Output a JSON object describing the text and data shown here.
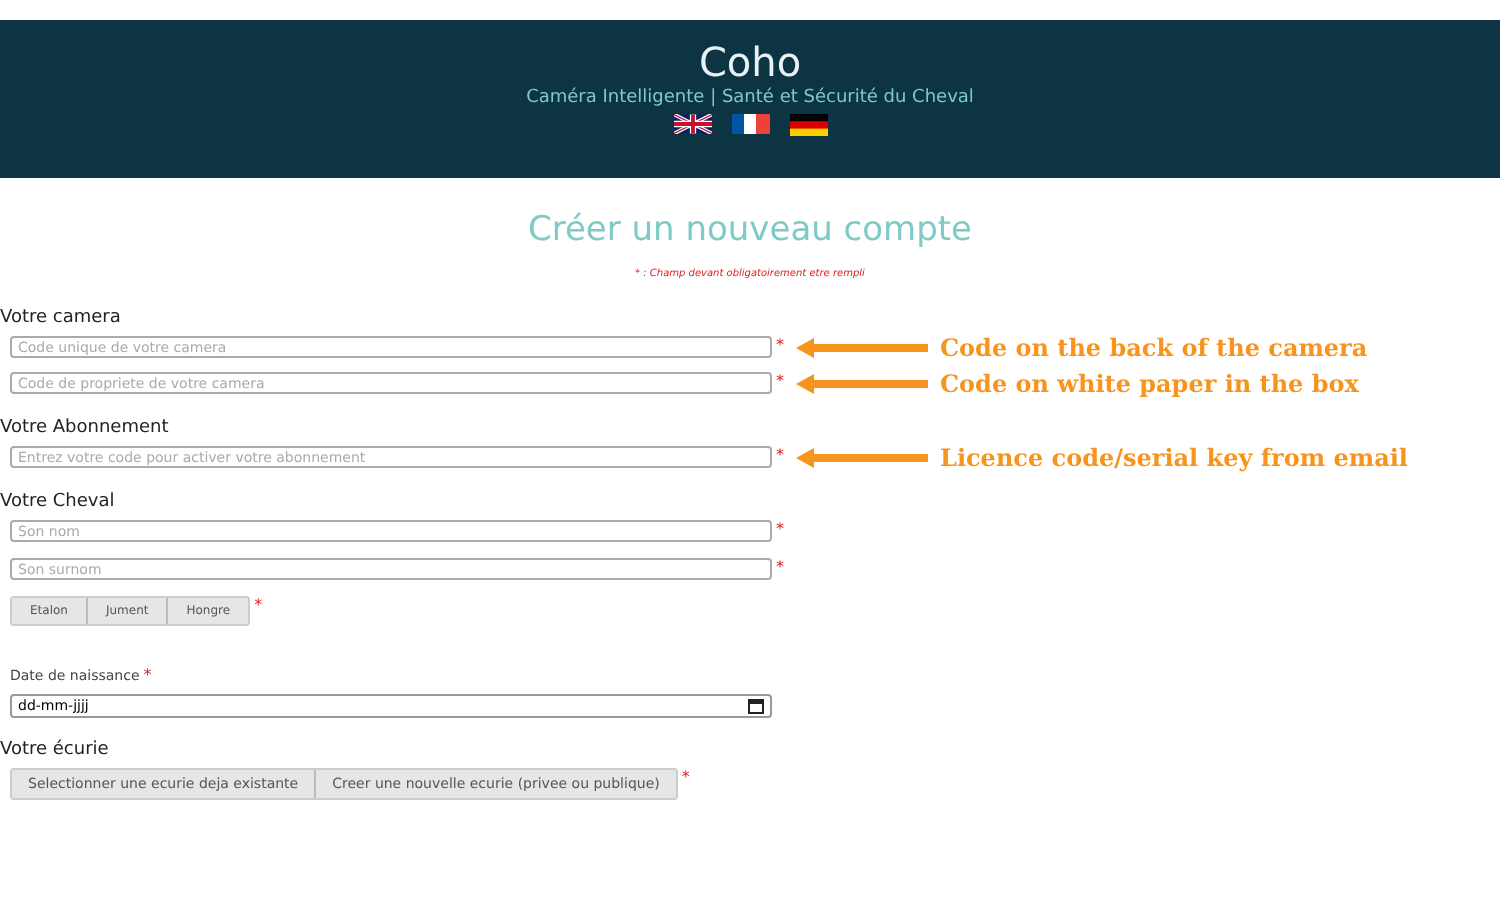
{
  "header": {
    "logo": "Coho",
    "tagline": "Caméra Intelligente | Santé et Sécurité du Cheval",
    "languages": [
      {
        "kind": "uk"
      },
      {
        "kind": "fr"
      },
      {
        "kind": "de"
      }
    ]
  },
  "title": "Créer un nouveau compte",
  "required_note": "* : Champ devant obligatoirement etre rempli",
  "sections": [
    {
      "heading": "Votre camera",
      "items": [
        {
          "kind": "text",
          "placeholder": "Code unique de votre camera",
          "required_mark": "*",
          "annotation": "Code on the back of the camera"
        },
        {
          "kind": "text",
          "placeholder": "Code de propriete de votre camera",
          "required_mark": "*",
          "annotation": "Code on white paper in the box"
        }
      ]
    },
    {
      "heading": "Votre Abonnement",
      "items": [
        {
          "kind": "text",
          "placeholder": "Entrez votre code pour activer votre abonnement",
          "required_mark": "*",
          "annotation": "Licence code/serial key from email"
        }
      ]
    },
    {
      "heading": "Votre Cheval",
      "items": [
        {
          "kind": "text",
          "placeholder": "Son nom",
          "required_mark": "*"
        },
        {
          "kind": "text",
          "placeholder": "Son surnom",
          "required_mark": "*"
        },
        {
          "kind": "segmented",
          "options": [
            "Etalon",
            "Jument",
            "Hongre"
          ],
          "required_mark": "*"
        },
        {
          "kind": "date",
          "label": "Date de naissance",
          "value": "dd-mm-jjjj",
          "required_mark": "*"
        }
      ]
    },
    {
      "heading": "Votre écurie",
      "items": [
        {
          "kind": "segmented",
          "options": [
            "Selectionner une ecurie deja existante",
            "Creer une nouvelle ecurie (privee ou publique)"
          ],
          "required_mark": "*"
        }
      ]
    }
  ]
}
